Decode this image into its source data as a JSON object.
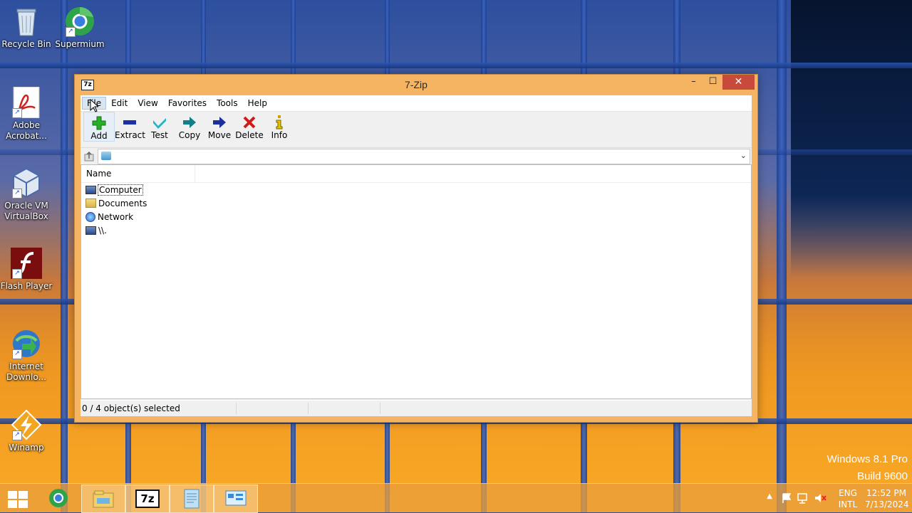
{
  "desktop": {
    "icons": [
      {
        "label": "Recycle Bin",
        "icon": "recycle-bin-icon"
      },
      {
        "label": "Supermium",
        "icon": "supermium-icon"
      },
      {
        "label": "Adobe Acrobat...",
        "icon": "adobe-acrobat-icon"
      },
      {
        "label": "Oracle VM VirtualBox",
        "icon": "virtualbox-icon"
      },
      {
        "label": "Flash Player",
        "icon": "flash-player-icon"
      },
      {
        "label": "Internet Downlo...",
        "icon": "internet-download-manager-icon"
      },
      {
        "label": "Winamp",
        "icon": "winamp-icon"
      }
    ],
    "watermark": {
      "line1": "Windows 8.1 Pro",
      "line2": "Build 9600"
    }
  },
  "window": {
    "title": "7-Zip",
    "app_icon_text": "7z",
    "controls": {
      "minimize": "–",
      "maximize": "☐",
      "close": "✕"
    },
    "menu": [
      "File",
      "Edit",
      "View",
      "Favorites",
      "Tools",
      "Help"
    ],
    "toolbar": [
      {
        "label": "Add",
        "icon": "add-icon",
        "color": "#1fa31f"
      },
      {
        "label": "Extract",
        "icon": "extract-icon",
        "color": "#1a2fa8"
      },
      {
        "label": "Test",
        "icon": "test-icon",
        "color": "#1fb5c9"
      },
      {
        "label": "Copy",
        "icon": "copy-icon",
        "color": "#0f7f8a"
      },
      {
        "label": "Move",
        "icon": "move-icon",
        "color": "#1b2f9e"
      },
      {
        "label": "Delete",
        "icon": "delete-icon",
        "color": "#d01a1a"
      },
      {
        "label": "Info",
        "icon": "info-icon",
        "color": "#c9a400"
      }
    ],
    "address": {
      "value": ""
    },
    "list": {
      "columns": [
        "Name"
      ],
      "rows": [
        {
          "name": "Computer",
          "icon": "computer-icon"
        },
        {
          "name": "Documents",
          "icon": "folder-icon"
        },
        {
          "name": "Network",
          "icon": "network-icon"
        },
        {
          "name": "\\\\.",
          "icon": "computer-icon"
        }
      ]
    },
    "status": "0 / 4 object(s) selected"
  },
  "taskbar": {
    "items": [
      "supermium",
      "file-explorer",
      "7-zip",
      "notepad",
      "control-panel"
    ],
    "tray": {
      "language": "ENG",
      "layout": "INTL",
      "time": "12:52 PM",
      "date": "7/13/2024"
    }
  }
}
